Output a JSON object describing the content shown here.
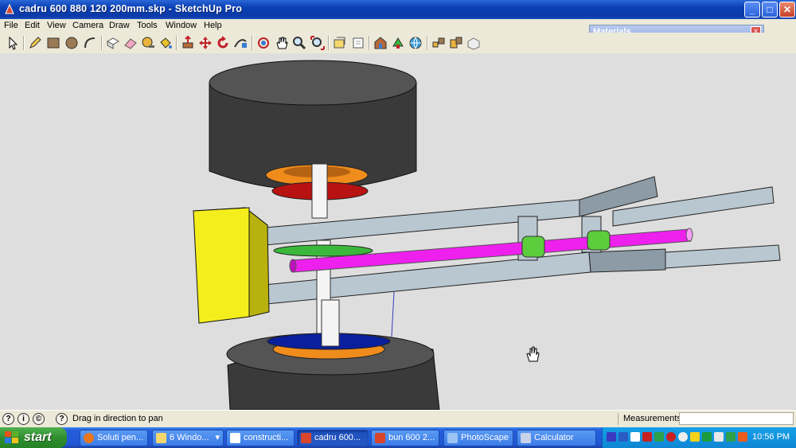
{
  "window": {
    "title": "cadru 600 880 120 200mm.skp - SketchUp Pro",
    "minimize": "_",
    "maximize": "□",
    "close": "✕"
  },
  "menu": [
    "File",
    "Edit",
    "View",
    "Camera",
    "Draw",
    "Tools",
    "Window",
    "Help"
  ],
  "toolbar": {
    "tools": [
      "select-icon",
      "pencil-icon",
      "rectangle-icon",
      "circle-icon",
      "arc-icon",
      "make-component-icon",
      "eraser-icon",
      "tape-measure-icon",
      "paint-bucket-icon",
      "push-pull-icon",
      "move-icon",
      "rotate-icon",
      "follow-me-icon",
      "orbit-icon",
      "pan-icon",
      "zoom-icon",
      "zoom-extents-icon",
      "previous-view-icon",
      "next-view-icon",
      "warehouse-icon",
      "share-model-icon",
      "geolocate-icon",
      "components-icon",
      "extension-icon",
      "layout-icon"
    ]
  },
  "materials_panel": {
    "title": "Materials",
    "close": "x"
  },
  "status": {
    "text": "Drag in direction to pan",
    "measurements_label": "Measurements",
    "measurements_value": ""
  },
  "taskbar": {
    "start_label": "start",
    "tasks": [
      {
        "label": "Soluti pen...",
        "icon": "firefox-icon",
        "color": "#e8761c",
        "active": false
      },
      {
        "label": "6 Windo...",
        "icon": "folder-icon",
        "color": "#f5d76e",
        "active": false
      },
      {
        "label": "constructi...",
        "icon": "document-icon",
        "color": "#ffffff",
        "active": false
      },
      {
        "label": "cadru 600...",
        "icon": "sketchup-icon",
        "color": "#d9452b",
        "active": true
      },
      {
        "label": "bun 600 2...",
        "icon": "sketchup-icon",
        "color": "#d9452b",
        "active": false
      },
      {
        "label": "PhotoScape",
        "icon": "photoscape-icon",
        "color": "#9bc4f5",
        "active": false
      },
      {
        "label": "Calculator",
        "icon": "calculator-icon",
        "color": "#c8d2e8",
        "active": false
      }
    ],
    "clock": "10:56 PM"
  },
  "colors": {
    "tire": "#3a3a3a",
    "hub_orange": "#f08c1c",
    "disc_red": "#b81212",
    "disc_blue": "#0a1f9c",
    "frame": "#b9c7d0",
    "motor_yellow": "#f4ee1c",
    "shaft_magenta": "#ee20ee",
    "bearing_green": "#5ccd3c",
    "disc_green": "#3bb83b"
  }
}
